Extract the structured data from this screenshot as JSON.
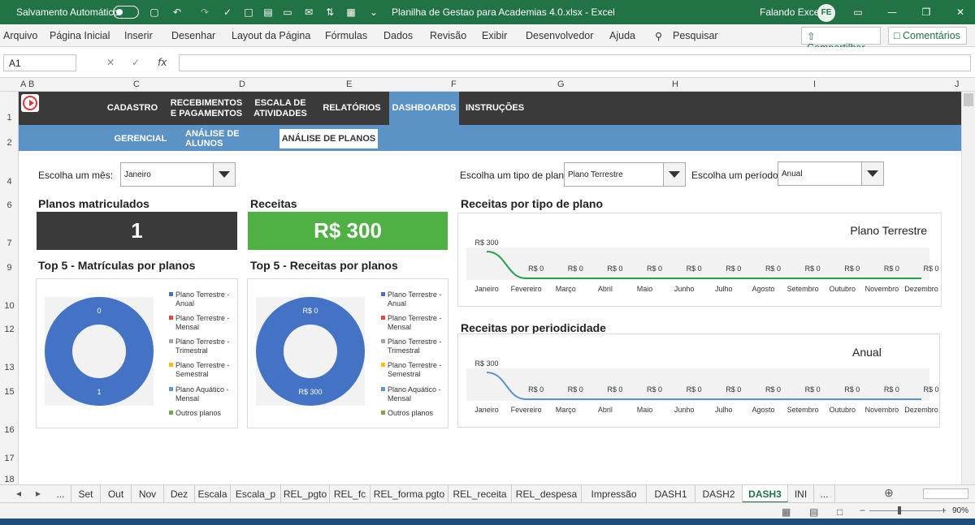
{
  "titlebar": {
    "autosave_label": "Salvamento Automático",
    "file_title": "Planilha de Gestao para Academias 4.0.xlsx  -  Excel",
    "user_name": "Falando Excel",
    "user_initials": "FE"
  },
  "ribbon": {
    "tabs": [
      "Arquivo",
      "Página Inicial",
      "Inserir",
      "Desenhar",
      "Layout da Página",
      "Fórmulas",
      "Dados",
      "Revisão",
      "Exibir",
      "Desenvolvedor",
      "Ajuda",
      "Pesquisar"
    ],
    "share_label": "Compartilhar",
    "comments_label": "Comentários"
  },
  "formula_bar": {
    "name_box": "A1",
    "fx": "fx",
    "formula": ""
  },
  "columns": [
    "A",
    "B",
    "C",
    "D",
    "E",
    "F",
    "G",
    "H",
    "I",
    "J"
  ],
  "rows": [
    "1",
    "2",
    "4",
    "6",
    "7",
    "9",
    "10",
    "12",
    "13",
    "15",
    "16",
    "17",
    "18"
  ],
  "nav": {
    "items": [
      "CADASTRO",
      "RECEBIMENTOS\nE PAGAMENTOS",
      "ESCALA DE\nATIVIDADES",
      "RELATÓRIOS",
      "DASHBOARDS",
      "INSTRUÇÕES"
    ],
    "active": "DASHBOARDS"
  },
  "subnav": {
    "items": [
      "GERENCIAL",
      "ANÁLISE DE ALUNOS",
      "ANÁLISE DE PLANOS"
    ],
    "active": "ANÁLISE DE PLANOS"
  },
  "filters": {
    "month_label": "Escolha um mês:",
    "month_value": "Janeiro",
    "plan_type_label": "Escolha um tipo de plano",
    "plan_type_value": "Plano Terrestre",
    "period_label": "Escolha um período:",
    "period_value": "Anual"
  },
  "kpis": {
    "enrolled_title": "Planos matriculados",
    "enrolled_value": "1",
    "revenue_title": "Receitas",
    "revenue_value": "R$ 300"
  },
  "accent_colors": {
    "dark": "#3a3a3a",
    "blue": "#5b93c6",
    "green": "#4fb143",
    "excel_green": "#217346"
  },
  "chart_data": [
    {
      "type": "pie",
      "title": "Top 5 - Matrículas por planos",
      "categories": [
        "Plano Terrestre - Anual",
        "Plano Terrestre - Mensal",
        "Plano Terrestre - Trimestral",
        "Plano Terrestre - Semestral",
        "Plano Aquático - Mensal",
        "Outros planos"
      ],
      "values": [
        1,
        0,
        0,
        0,
        0,
        0
      ],
      "data_labels": [
        "0",
        "1"
      ],
      "colors": [
        "#4472c4",
        "#e04a3f",
        "#a5a5a5",
        "#ffc000",
        "#5b9bd5",
        "#70ad47"
      ]
    },
    {
      "type": "pie",
      "title": "Top 5 - Receitas por planos",
      "categories": [
        "Plano Terrestre - Anual",
        "Plano Terrestre - Mensal",
        "Plano Terrestre - Trimestral",
        "Plano Terrestre - Semestral",
        "Plano Aquático - Mensal",
        "Outros planos"
      ],
      "values": [
        300,
        0,
        0,
        0,
        0,
        0
      ],
      "data_labels": [
        "R$ 0",
        "R$ 300"
      ],
      "colors": [
        "#4472c4",
        "#e04a3f",
        "#a5a5a5",
        "#ffc000",
        "#5b9bd5",
        "#70ad47"
      ]
    },
    {
      "type": "line",
      "title": "Receitas por tipo de plano",
      "series_label": "Plano Terrestre",
      "categories": [
        "Janeiro",
        "Fevereiro",
        "Março",
        "Abril",
        "Maio",
        "Junho",
        "Julho",
        "Agosto",
        "Setembro",
        "Outubro",
        "Novembro",
        "Dezembro"
      ],
      "values": [
        300,
        0,
        0,
        0,
        0,
        0,
        0,
        0,
        0,
        0,
        0,
        0
      ],
      "labels": [
        "R$ 300",
        "R$ 0",
        "R$ 0",
        "R$ 0",
        "R$ 0",
        "R$ 0",
        "R$ 0",
        "R$ 0",
        "R$ 0",
        "R$ 0",
        "R$ 0",
        "R$ 0"
      ],
      "color": "#22a04a"
    },
    {
      "type": "line",
      "title": "Receitas por periodicidade",
      "series_label": "Anual",
      "categories": [
        "Janeiro",
        "Fevereiro",
        "Março",
        "Abril",
        "Maio",
        "Junho",
        "Julho",
        "Agosto",
        "Setembro",
        "Outubro",
        "Novembro",
        "Dezembro"
      ],
      "values": [
        300,
        0,
        0,
        0,
        0,
        0,
        0,
        0,
        0,
        0,
        0,
        0
      ],
      "labels": [
        "R$ 300",
        "R$ 0",
        "R$ 0",
        "R$ 0",
        "R$ 0",
        "R$ 0",
        "R$ 0",
        "R$ 0",
        "R$ 0",
        "R$ 0",
        "R$ 0",
        "R$ 0"
      ],
      "color": "#5b93c6"
    }
  ],
  "sheet_tabs": [
    "...",
    "Set",
    "Out",
    "Nov",
    "Dez",
    "Escala",
    "Escala_p",
    "REL_pgto",
    "REL_fc",
    "REL_forma pgto",
    "REL_receita",
    "REL_despesa",
    "Impressão",
    "DASH1",
    "DASH2",
    "DASH3",
    "INI",
    "..."
  ],
  "active_sheet": "DASH3",
  "zoom": "90%"
}
